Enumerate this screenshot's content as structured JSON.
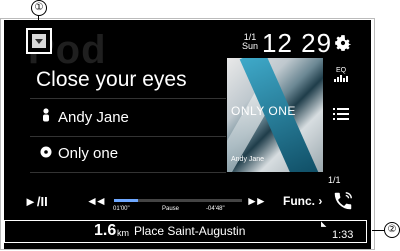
{
  "callouts": {
    "one": "①",
    "two": "②"
  },
  "header": {
    "menu_icon": "chevron-down-icon",
    "date_month_day": "1/1",
    "date_weekday": "Sun",
    "clock": "12 29",
    "settings_icon": "gear-icon"
  },
  "background_word": "Pod",
  "track": {
    "title": "Close your eyes",
    "artist": "Andy Jane",
    "album": "Only one"
  },
  "artwork": {
    "title": "ONLY ONE",
    "artist": "Andy Jane"
  },
  "side": {
    "eq_label": "EQ",
    "page_indicator": "1/1"
  },
  "controls": {
    "play_pause": "►/II",
    "prev": "◄◄",
    "next": "►►",
    "elapsed": "01'00\"",
    "state": "Pause",
    "remaining": "-04'48\"",
    "progress": 0.19,
    "func_label": "Func. ›"
  },
  "navigation": {
    "distance_value": "1.6",
    "distance_unit": "km",
    "street": "Place Saint-Augustin",
    "eta": "1:33"
  },
  "colors": {
    "background": "#000000",
    "text": "#ffffff",
    "progress": "#6fa8ff"
  }
}
